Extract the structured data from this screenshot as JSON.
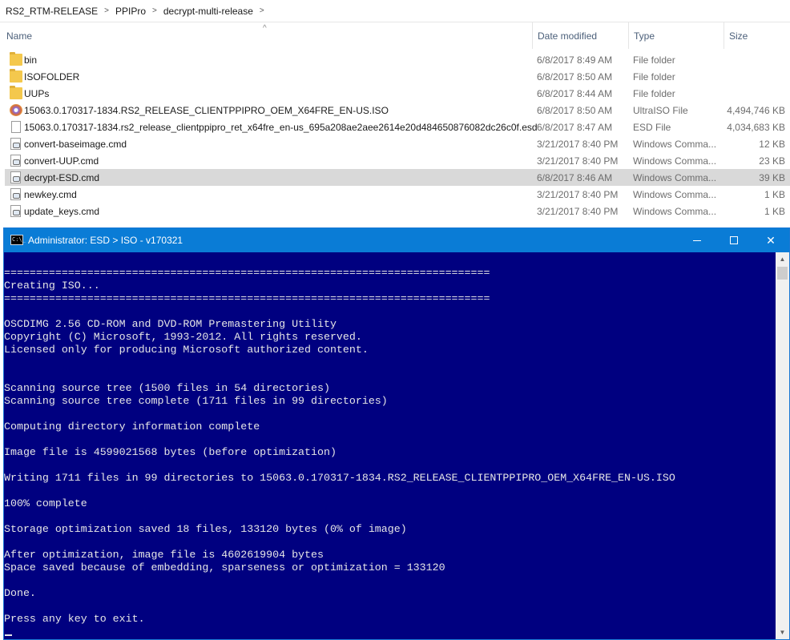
{
  "explorer": {
    "breadcrumb": [
      "RS2_RTM-RELEASE",
      "PPIPro",
      "decrypt-multi-release"
    ],
    "columns": {
      "name": "Name",
      "date": "Date modified",
      "type": "Type",
      "size": "Size"
    },
    "files": [
      {
        "name": "bin",
        "date": "6/8/2017 8:49 AM",
        "type": "File folder",
        "size": "",
        "icon": "folder-icon"
      },
      {
        "name": "ISOFOLDER",
        "date": "6/8/2017 8:50 AM",
        "type": "File folder",
        "size": "",
        "icon": "folder-icon"
      },
      {
        "name": "UUPs",
        "date": "6/8/2017 8:44 AM",
        "type": "File folder",
        "size": "",
        "icon": "folder-icon"
      },
      {
        "name": "15063.0.170317-1834.RS2_RELEASE_CLIENTPPIPRO_OEM_X64FRE_EN-US.ISO",
        "date": "6/8/2017 8:50 AM",
        "type": "UltraISO File",
        "size": "4,494,746 KB",
        "icon": "disc-image-icon"
      },
      {
        "name": "15063.0.170317-1834.rs2_release_clientppipro_ret_x64fre_en-us_695a208ae2aee2614e20d484650876082dc26c0f.esd",
        "date": "6/8/2017 8:47 AM",
        "type": "ESD File",
        "size": "4,034,683 KB",
        "icon": "file-icon"
      },
      {
        "name": "convert-baseimage.cmd",
        "date": "3/21/2017 8:40 PM",
        "type": "Windows Comma...",
        "size": "12 KB",
        "icon": "cmd-script-icon"
      },
      {
        "name": "convert-UUP.cmd",
        "date": "3/21/2017 8:40 PM",
        "type": "Windows Comma...",
        "size": "23 KB",
        "icon": "cmd-script-icon"
      },
      {
        "name": "decrypt-ESD.cmd",
        "date": "6/8/2017 8:46 AM",
        "type": "Windows Comma...",
        "size": "39 KB",
        "icon": "cmd-script-icon"
      },
      {
        "name": "newkey.cmd",
        "date": "3/21/2017 8:40 PM",
        "type": "Windows Comma...",
        "size": "1 KB",
        "icon": "cmd-script-icon"
      },
      {
        "name": "update_keys.cmd",
        "date": "3/21/2017 8:40 PM",
        "type": "Windows Comma...",
        "size": "1 KB",
        "icon": "cmd-script-icon"
      }
    ]
  },
  "console": {
    "title": "Administrator:  ESD > ISO - v170321",
    "icon_label": "C:\\_",
    "lines": [
      "============================================================================",
      "Creating ISO...",
      "============================================================================",
      "",
      "OSCDIMG 2.56 CD-ROM and DVD-ROM Premastering Utility",
      "Copyright (C) Microsoft, 1993-2012. All rights reserved.",
      "Licensed only for producing Microsoft authorized content.",
      "",
      "",
      "Scanning source tree (1500 files in 54 directories)",
      "Scanning source tree complete (1711 files in 99 directories)",
      "",
      "Computing directory information complete",
      "",
      "Image file is 4599021568 bytes (before optimization)",
      "",
      "Writing 1711 files in 99 directories to 15063.0.170317-1834.RS2_RELEASE_CLIENTPPIPRO_OEM_X64FRE_EN-US.ISO",
      "",
      "100% complete",
      "",
      "Storage optimization saved 18 files, 133120 bytes (0% of image)",
      "",
      "After optimization, image file is 4602619904 bytes",
      "Space saved because of embedding, sparseness or optimization = 133120",
      "",
      "Done.",
      "",
      "Press any key to exit."
    ]
  }
}
